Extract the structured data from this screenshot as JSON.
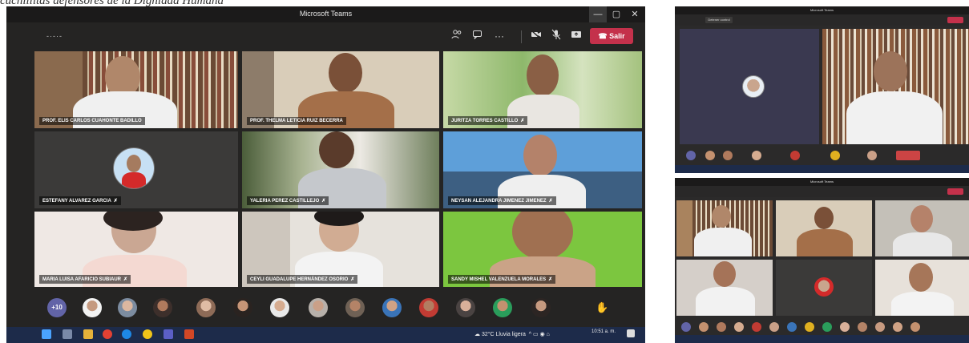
{
  "caption": "cuchillitas defensores de la Dignidad Humana",
  "main": {
    "title": "Microsoft Teams",
    "leave_label": "Salir",
    "participants": [
      {
        "name": "PROF. ELIS CARLOS CUAHONTE BADILLO",
        "muted": false
      },
      {
        "name": "PROF. THELMA LETICIA RUIZ BECERRA",
        "muted": false
      },
      {
        "name": "JURITZA TORRES CASTILLO",
        "muted": true
      },
      {
        "name": "ESTEFANY ALVAREZ GARCIA",
        "muted": true
      },
      {
        "name": "YALERIA PEREZ CASTILLEJO",
        "muted": true
      },
      {
        "name": "NEYSAN ALEJANDRA JIMENEZ JIMENEZ",
        "muted": true
      },
      {
        "name": "MARIA LUISA AFARICIO SUBIAUR",
        "muted": true
      },
      {
        "name": "CEYLI GUADALUPE HERNÁNDEZ OSORIO",
        "muted": true
      },
      {
        "name": "SANDY MISHEL VALENZUELA MORALES",
        "muted": true
      }
    ],
    "overflow_count": "+10",
    "taskbar": {
      "weather": "32°C  Lluvia ligera",
      "time": "10:51 a. m."
    }
  },
  "side_top": {
    "title": "Microsoft Teams",
    "button_label": "Detener control"
  },
  "side_bottom": {
    "title": "Microsoft Teams"
  },
  "icons": [
    "people-icon",
    "chat-icon",
    "more-icon",
    "camera-icon",
    "mic-off-icon",
    "share-icon",
    "phone-icon",
    "raise-hand-icon"
  ],
  "colors": {
    "teams_purple": "#6264a7",
    "leave_red": "#c4314b"
  }
}
